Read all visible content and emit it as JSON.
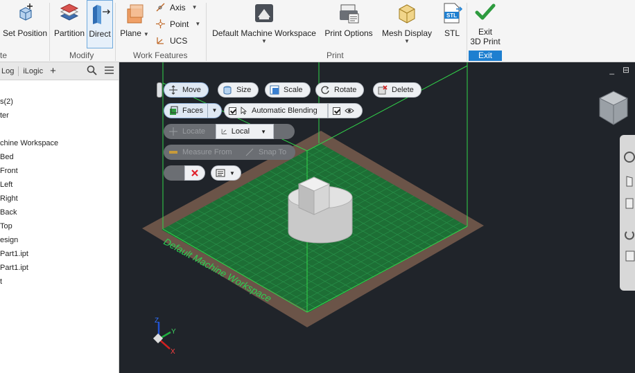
{
  "ribbon": {
    "set_position": "Set Position",
    "partition": "Partition",
    "direct": "Direct",
    "plane": "Plane",
    "axis": "Axis",
    "point": "Point",
    "ucs": "UCS",
    "default_workspace": "Default Machine Workspace",
    "print_options": "Print Options",
    "mesh_display": "Mesh Display",
    "stl": "STL",
    "stl_icon_text": "STL",
    "exit_3d_print": "Exit",
    "exit_3d_print_line2": "3D Print",
    "panels": {
      "left_cut": "te",
      "modify": "Modify",
      "work_features": "Work Features",
      "print": "Print",
      "exit": "Exit"
    }
  },
  "browser": {
    "tab_log": "Log",
    "tab_ilogic": "iLogic",
    "add": "+",
    "items": [
      "s(2)",
      "ter",
      "",
      "chine Workspace",
      "Bed",
      "Front",
      "Left",
      "Right",
      "Back",
      "Top",
      "esign",
      "Part1.ipt",
      "Part1.ipt",
      "t"
    ]
  },
  "minitoolbar": {
    "move": "Move",
    "size": "Size",
    "scale": "Scale",
    "rotate": "Rotate",
    "delete": "Delete",
    "faces": "Faces",
    "automatic_blending": "Automatic Blending",
    "locate": "Locate",
    "local": "Local",
    "measure_from": "Measure From",
    "snap_to": "Snap To"
  },
  "viewport": {
    "bed_label": "Default Machine Workspace",
    "axis_x": "X",
    "axis_y": "Y",
    "axis_z": "Z",
    "minimize": "_",
    "restore": "⊟"
  },
  "colors": {
    "accent": "#1e7fd0",
    "exit_green": "#2e9b3f",
    "grid_green": "#1f7a3a",
    "bed_brown": "#6b5448",
    "workspace_line": "#31d64a"
  }
}
